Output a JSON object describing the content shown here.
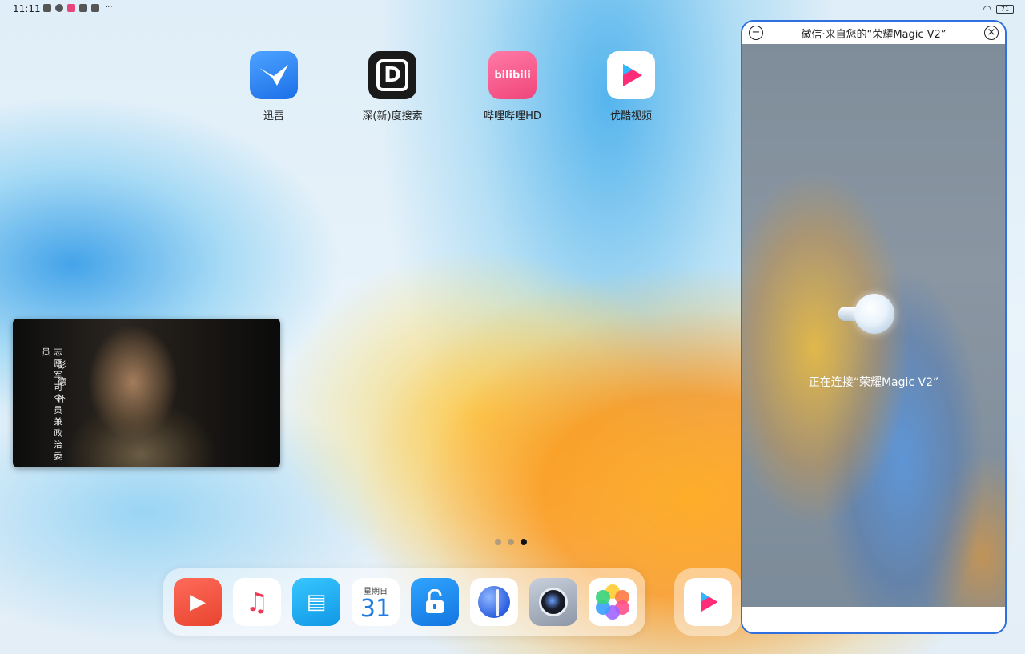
{
  "status_bar": {
    "time": "11:11",
    "more": "···",
    "battery": "71"
  },
  "home_apps": [
    {
      "label": "迅雷",
      "icon": "xunlei-bird-icon"
    },
    {
      "label": "深(新)度搜索",
      "icon": "deep-search-icon",
      "glyph": "D"
    },
    {
      "label": "哔哩哔哩HD",
      "icon": "bilibili-icon",
      "glyph": "bilibili"
    },
    {
      "label": "优酷视频",
      "icon": "youku-icon"
    }
  ],
  "pip_video": {
    "caption_title": "志愿军司令员兼政治委员",
    "caption_name": "彭德怀"
  },
  "page_indicator": {
    "count": 3,
    "active": 3
  },
  "dock": {
    "calendar_weekday": "星期日",
    "calendar_day": "31"
  },
  "floating_window": {
    "title": "微信·来自您的“荣耀Magic V2”",
    "status": "正在连接“荣耀Magic V2”"
  },
  "colors": {
    "window_border": "#2f6fe0",
    "accent": "#1e7be3"
  }
}
